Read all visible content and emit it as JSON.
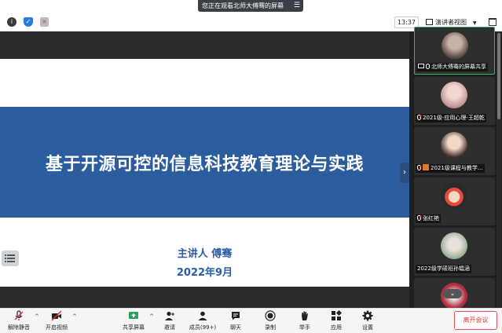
{
  "banner": {
    "text": "您正在观看北师大傅骞的屏幕",
    "menu_icon": "menu-icon"
  },
  "toolbar": {
    "info_icon": "info-icon",
    "shield_icon": "shield-icon",
    "record_icon": "record-off-icon",
    "time": "13:37",
    "view_label": "演讲者视图",
    "window_icon": "window-icon"
  },
  "slide": {
    "title": "基于开源可控的信息科技教育理论与实践",
    "presenter": "主讲人 傅骞",
    "date": "2022年9月",
    "band_color": "#2b5c9e",
    "text_color": "#2b5ca6"
  },
  "participants": [
    {
      "name": "北师大傅骞的屏幕共享",
      "active": true,
      "sharing": true
    },
    {
      "name": "2021级-应用心理-王超乾",
      "active": false
    },
    {
      "name": "2021级课程与教学...",
      "active": false,
      "badge": true
    },
    {
      "name": "张红艳",
      "active": false
    },
    {
      "name": "2022级学硕班孙韫涵",
      "active": false,
      "no_icon": true
    },
    {
      "name": "",
      "active": false
    }
  ],
  "bottom": {
    "unmute": "解除静音",
    "video": "开启视频",
    "share": "共享屏幕",
    "invite": "邀请",
    "members": "成员(99+)",
    "chat": "聊天",
    "record": "录制",
    "raise_hand": "举手",
    "apps": "应用",
    "settings": "设置",
    "leave": "离开会议",
    "leave_color": "#e03a3a"
  }
}
